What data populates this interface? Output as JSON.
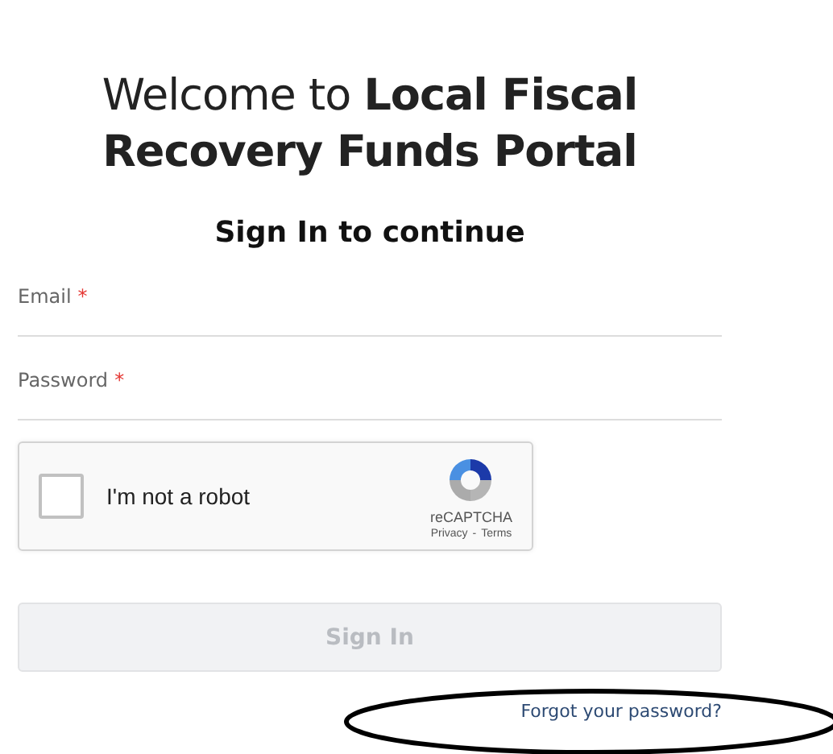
{
  "heading": "Welcome to **Local Fiscal Recovery Funds Portal**",
  "subheading": "Sign In to continue",
  "fields": [
    {
      "label": "Email",
      "required": true,
      "required_mark": "*"
    },
    {
      "label": "Password",
      "required": true,
      "required_mark": "*"
    }
  ],
  "captcha": {
    "label": "I'm not a robot",
    "checked": false,
    "brand": "reCAPTCHA",
    "privacy": "Privacy",
    "separator": "-",
    "terms": "Terms"
  },
  "sign_in_button": {
    "label": "Sign In",
    "disabled": true
  },
  "forgot_link": {
    "label": "Forgot your password?",
    "circled": true
  }
}
